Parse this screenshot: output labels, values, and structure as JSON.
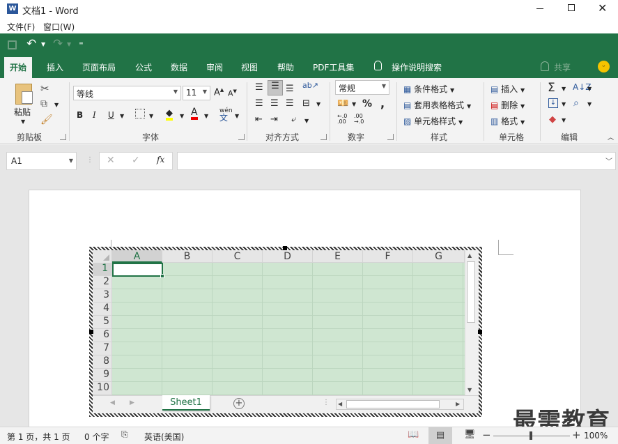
{
  "window": {
    "title": "文档1 - Word",
    "app_icon": "W"
  },
  "menubar": {
    "items": [
      "文件(F)",
      "窗口(W)"
    ]
  },
  "tabs": [
    {
      "label": "开始",
      "active": true
    },
    {
      "label": "插入"
    },
    {
      "label": "页面布局"
    },
    {
      "label": "公式"
    },
    {
      "label": "数据"
    },
    {
      "label": "审阅"
    },
    {
      "label": "视图"
    },
    {
      "label": "帮助"
    },
    {
      "label": "PDF工具集"
    }
  ],
  "tellme": "操作说明搜索",
  "share": "共享",
  "ribbon": {
    "clipboard": {
      "label": "剪贴板",
      "paste": "粘贴"
    },
    "font": {
      "label": "字体",
      "name": "等线",
      "size": "11",
      "bold": "B",
      "italic": "I",
      "underline": "U",
      "phonetic": "wén"
    },
    "align": {
      "label": "对齐方式"
    },
    "number": {
      "label": "数字",
      "format": "常规"
    },
    "styles": {
      "label": "样式",
      "items": [
        "条件格式",
        "套用表格格式",
        "单元格样式"
      ]
    },
    "cells": {
      "label": "单元格",
      "items": [
        "插入",
        "删除",
        "格式"
      ]
    },
    "editing": {
      "label": "编辑"
    }
  },
  "formula_bar": {
    "namebox": "A1",
    "value": "",
    "fx": "fx"
  },
  "sheet": {
    "columns": [
      "A",
      "B",
      "C",
      "D",
      "E",
      "F",
      "G"
    ],
    "rows": [
      "1",
      "2",
      "3",
      "4",
      "5",
      "6",
      "7",
      "8",
      "9",
      "10"
    ],
    "tab": "Sheet1"
  },
  "status": {
    "page": "第 1 页，共 1 页",
    "words": "0 个字",
    "lang": "英语(美国)",
    "zoom": "100%"
  },
  "watermark": "最需教育",
  "colors": {
    "accent": "#217346",
    "selection": "#cfe6d1"
  }
}
